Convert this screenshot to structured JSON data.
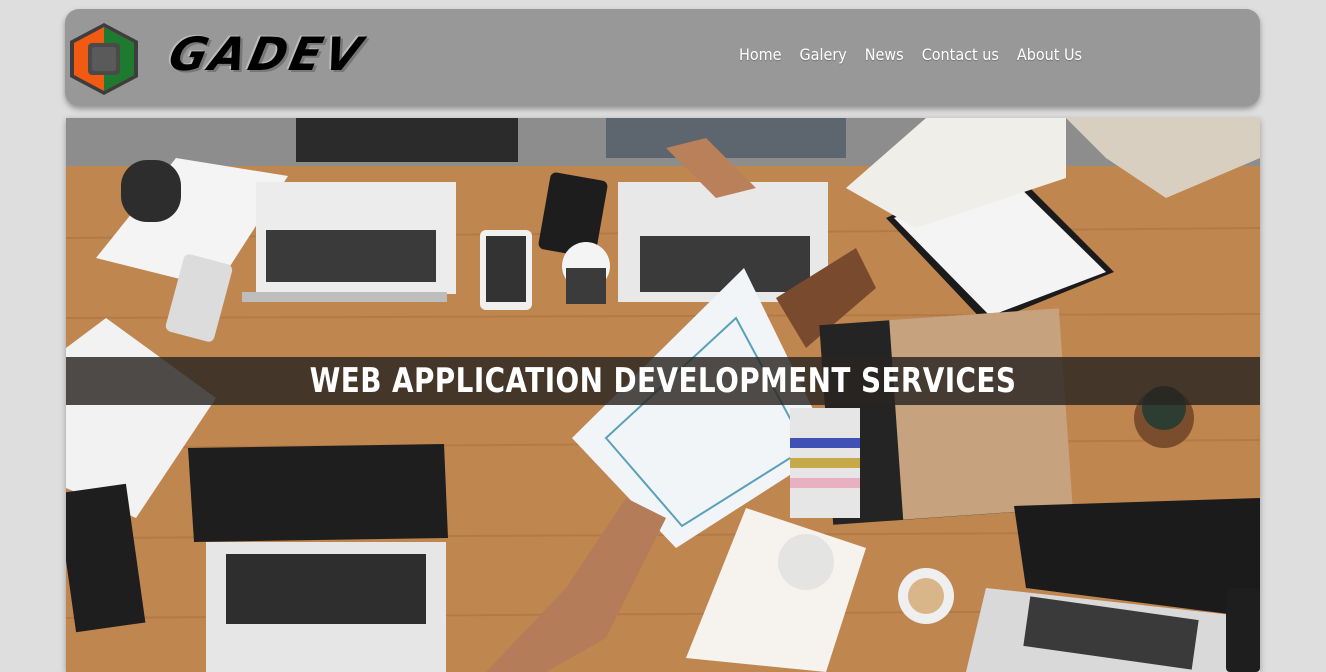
{
  "brand": {
    "name": "GADEV",
    "logo_icon": "hexagon-logo-icon",
    "colors": {
      "orange": "#f05a12",
      "green": "#1e7a2e",
      "dark": "#444444"
    }
  },
  "nav": {
    "items": [
      {
        "label": "Home"
      },
      {
        "label": "Galery"
      },
      {
        "label": "News"
      },
      {
        "label": "Contact us"
      },
      {
        "label": "About Us"
      }
    ]
  },
  "hero": {
    "title": "WEB APPLICATION DEVELOPMENT SERVICES",
    "image": "office-desk-photo"
  },
  "colors": {
    "page_bg": "#dedede",
    "header_bg": "#989898",
    "banner_bg": "#2a2522"
  }
}
